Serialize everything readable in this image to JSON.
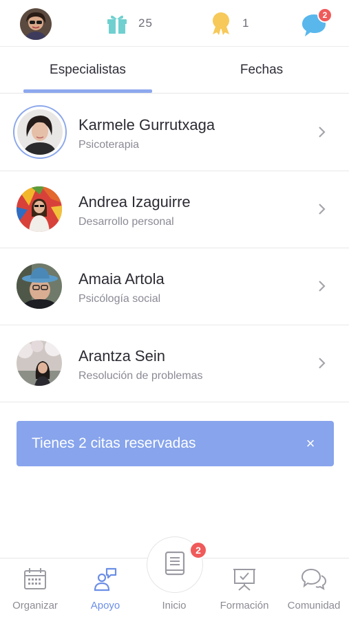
{
  "topbar": {
    "gift_count": "25",
    "medal_count": "1",
    "chat_badge": "2"
  },
  "tabs": [
    {
      "label": "Especialistas",
      "active": true
    },
    {
      "label": "Fechas",
      "active": false
    }
  ],
  "specialists": [
    {
      "name": "Karmele Gurrutxaga",
      "specialty": "Psicoterapia",
      "selected": true
    },
    {
      "name": "Andrea Izaguirre",
      "specialty": "Desarrollo personal",
      "selected": false
    },
    {
      "name": "Amaia Artola",
      "specialty": "Psicólogía social",
      "selected": false
    },
    {
      "name": "Arantza Sein",
      "specialty": "Resolución de problemas",
      "selected": false
    }
  ],
  "banner": {
    "text": "Tienes 2 citas reservadas",
    "close": "×"
  },
  "bottom_nav": {
    "items": [
      {
        "label": "Organizar",
        "icon": "calendar-icon"
      },
      {
        "label": "Apoyo",
        "icon": "support-icon",
        "active": true
      },
      {
        "label": "Inicio",
        "icon": "book-icon"
      },
      {
        "label": "Formación",
        "icon": "presentation-icon"
      },
      {
        "label": "Comunidad",
        "icon": "chat-bubbles-icon"
      }
    ],
    "home_badge": "2"
  },
  "colors": {
    "accent": "#87a4ec",
    "active_nav": "#6b8ee6",
    "badge": "#f05a5a",
    "gift": "#6fd0cf",
    "medal": "#f7c95a",
    "chat": "#59b7ec"
  }
}
